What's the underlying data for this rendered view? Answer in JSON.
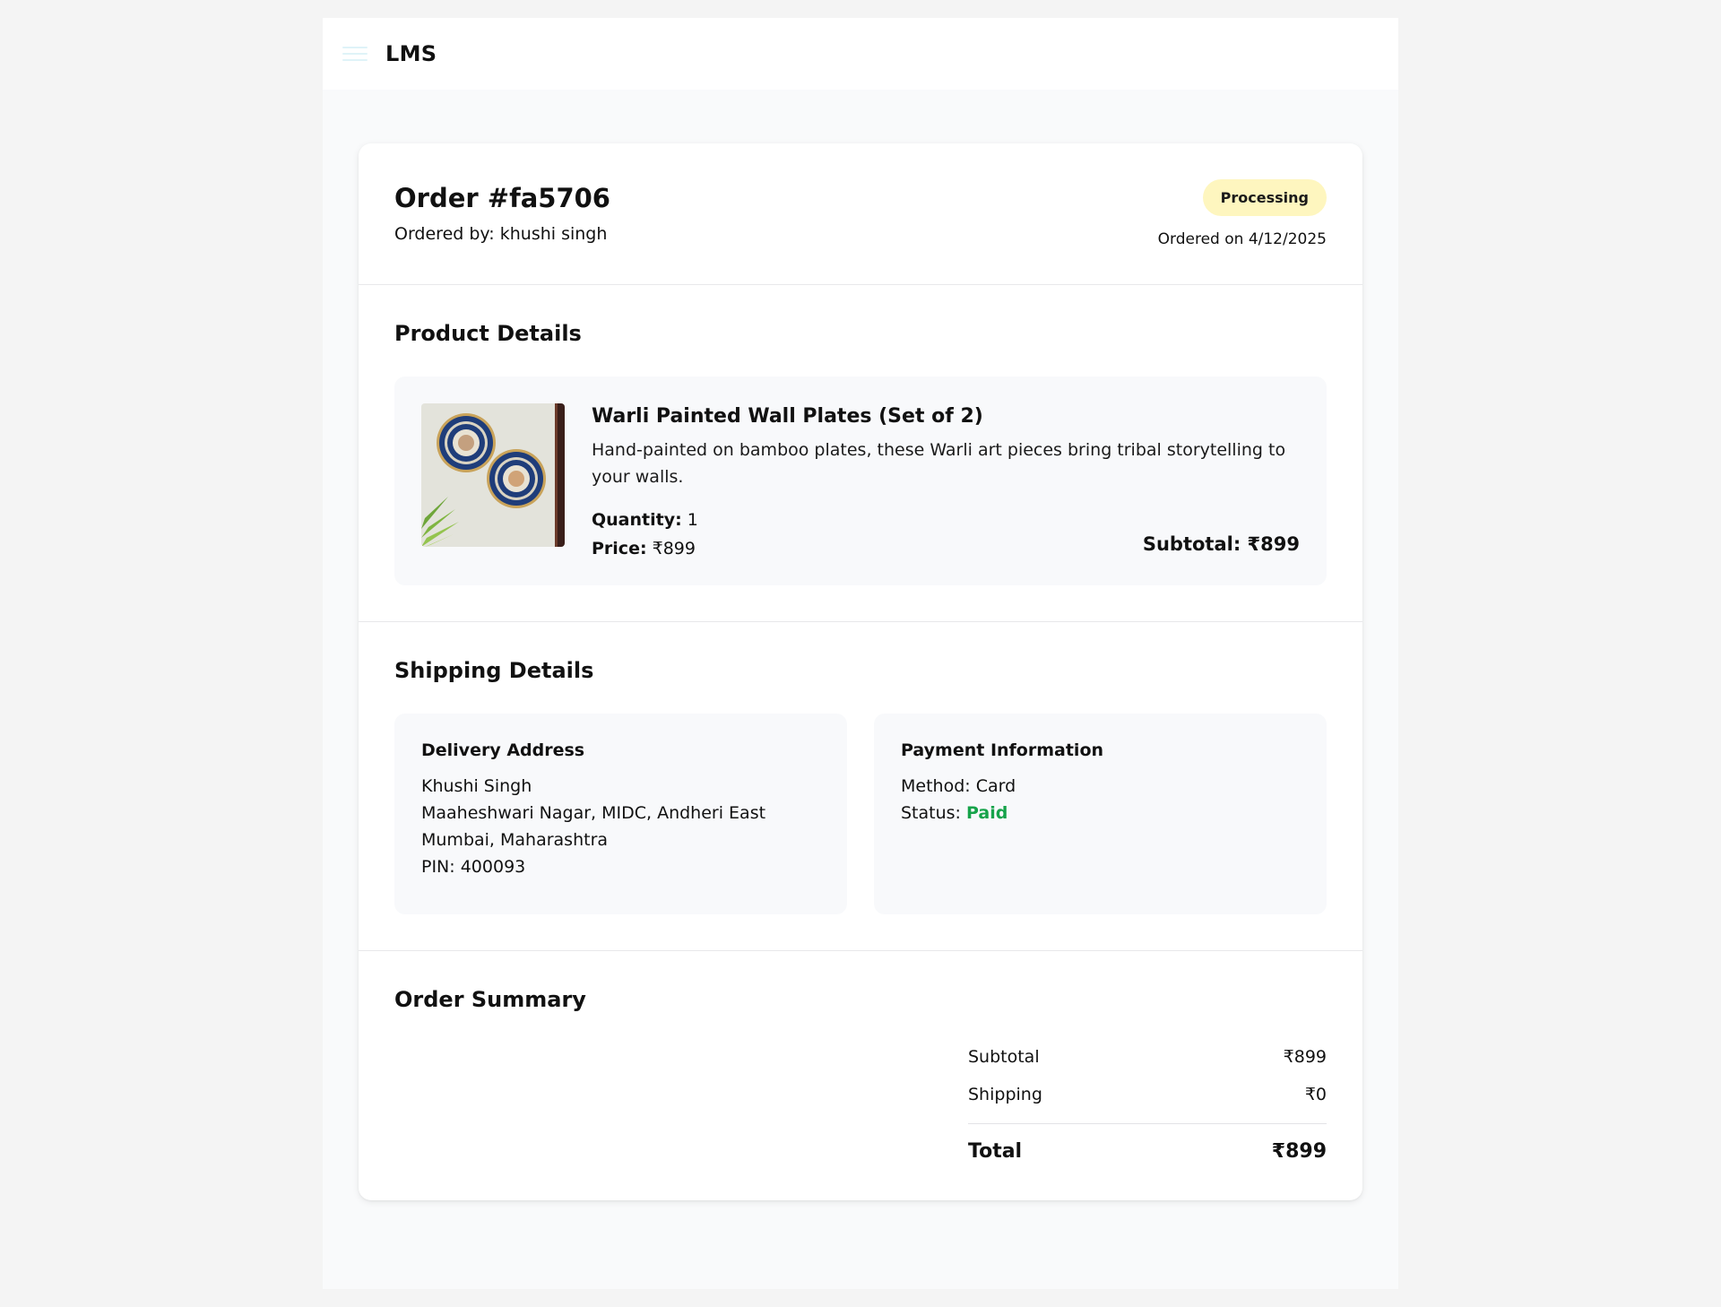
{
  "app": {
    "brand": "LMS",
    "menu_icon": "menu-icon"
  },
  "order": {
    "title": "Order #fa5706",
    "ordered_by": "Ordered by: khushi singh",
    "status": "Processing",
    "status_color": "#fef6bf",
    "ordered_on": "Ordered on 4/12/2025"
  },
  "product_section": {
    "title": "Product Details",
    "item": {
      "image_icon": "warli-wall-plates-image",
      "name": "Warli Painted Wall Plates (Set of 2)",
      "description": "Hand-painted on bamboo plates, these Warli art pieces bring tribal storytelling to your walls.",
      "quantity_label": "Quantity:",
      "quantity": "1",
      "price_label": "Price:",
      "price": "₹899",
      "subtotal": "Subtotal: ₹899"
    }
  },
  "shipping_section": {
    "title": "Shipping Details",
    "delivery": {
      "title": "Delivery Address",
      "name": "Khushi Singh",
      "line1": "Maaheshwari Nagar, MIDC, Andheri East",
      "line2": "Mumbai, Maharashtra",
      "pin": "PIN: 400093"
    },
    "payment": {
      "title": "Payment Information",
      "method": "Method: Card",
      "status_label": "Status:",
      "status": "Paid",
      "status_color": "#16a34a"
    }
  },
  "summary_section": {
    "title": "Order Summary",
    "rows": [
      {
        "label": "Subtotal",
        "value": "₹899"
      },
      {
        "label": "Shipping",
        "value": "₹0"
      }
    ],
    "total_label": "Total",
    "total_value": "₹899"
  }
}
